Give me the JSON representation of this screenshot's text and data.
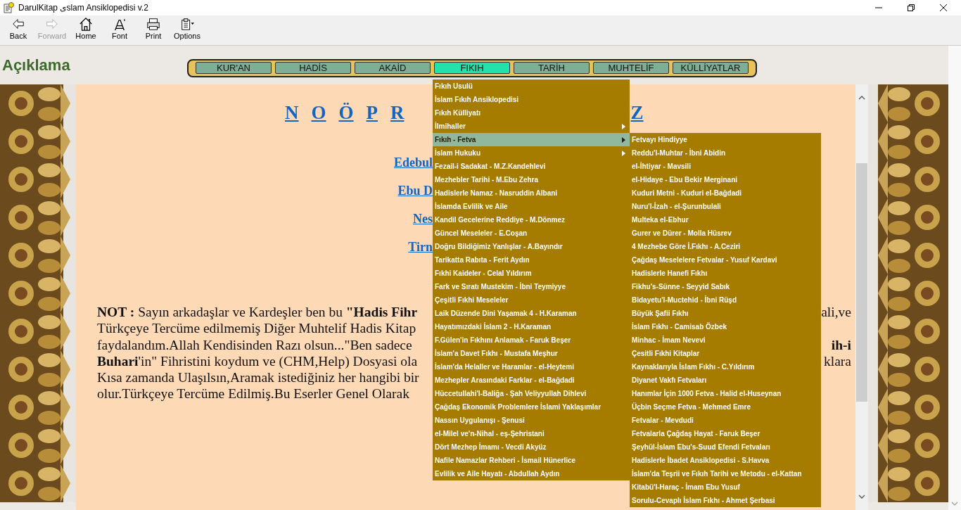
{
  "window": {
    "title": "DarulKitap ىslam Ansiklopedisi v.2"
  },
  "toolbar": [
    {
      "label": "Back",
      "kind": "back",
      "disabled": false
    },
    {
      "label": "Forward",
      "kind": "forward",
      "disabled": true
    },
    {
      "label": "Home",
      "kind": "home",
      "disabled": false
    },
    {
      "label": "Font",
      "kind": "font",
      "disabled": false
    },
    {
      "label": "Print",
      "kind": "print",
      "disabled": false
    },
    {
      "label": "Options",
      "kind": "options",
      "disabled": false
    }
  ],
  "header": {
    "title": "Açıklama"
  },
  "nav_tabs": [
    {
      "label": "KUR'AN",
      "selected": false
    },
    {
      "label": "HADİS",
      "selected": false
    },
    {
      "label": "AKAİD",
      "selected": false
    },
    {
      "label": "FIKIH",
      "selected": true
    },
    {
      "label": "TARİH",
      "selected": false
    },
    {
      "label": "MUHTELİF",
      "selected": false
    },
    {
      "label": "KÜLLİYATLAR",
      "selected": false
    }
  ],
  "content": {
    "letters": [
      "N",
      "O",
      "Ö",
      "P",
      "R"
    ],
    "last_letter": "Z",
    "links": [
      "Edebul",
      "Ebu D",
      "Nes",
      "Tirn"
    ],
    "note_lines": [
      {
        "left": "**NOT :** Sayın arkadaşlar ve Kardeşler ben bu **\"Hadis Fihr**",
        "right": {
          "text": "ali,ve",
          "bold": false
        }
      },
      {
        "left": "Türkçeye Tercüme edilmemiş Diğer Muhtelif Hadis Kitap"
      },
      {
        "left": "faydalandım.Allah Kendisinden Razı olsun...\"Ben sadece",
        "right": {
          "text": "ih-i",
          "bold": true
        }
      },
      {
        "left": "**Buhari**'in\" Fihristini koydum ve (CHM,Help) Dosyasi ola",
        "right": {
          "text": "klara",
          "bold": false
        }
      },
      {
        "left": "Kısa zamanda Ulaşılsın,Aramak istediğiniz her hangibi bir"
      },
      {
        "left": "olur.Türkçeye Tercüme Edilmiş.Bu Eserler Genel Olarak"
      }
    ]
  },
  "menu": {
    "items": [
      {
        "label": "Fıkıh Usulü",
        "selected": false,
        "has_submenu": false
      },
      {
        "label": "İslam Fıkıh Ansiklopedisi",
        "selected": false,
        "has_submenu": false
      },
      {
        "label": "Fıkıh Külliyatı",
        "selected": false,
        "has_submenu": false
      },
      {
        "label": "İlmihaller",
        "selected": false,
        "has_submenu": true
      },
      {
        "label": "Fıkıh - Fetva",
        "selected": true,
        "has_submenu": true
      },
      {
        "label": "İslam Hukuku",
        "selected": false,
        "has_submenu": true
      },
      {
        "label": "Fezail-i Sadakat - M.Z.Kandehlevi",
        "selected": false,
        "has_submenu": false
      },
      {
        "label": "Mezhebler Tarihi - M.Ebu Zehra",
        "selected": false,
        "has_submenu": false
      },
      {
        "label": "Hadislerle Namaz - Nasruddin Albani",
        "selected": false,
        "has_submenu": false
      },
      {
        "label": "İslamda Evlilik ve Aile",
        "selected": false,
        "has_submenu": false
      },
      {
        "label": "Kandil Gecelerine Reddiye - M.Dönmez",
        "selected": false,
        "has_submenu": false
      },
      {
        "label": "Güncel Meseleler - E.Coşan",
        "selected": false,
        "has_submenu": false
      },
      {
        "label": "Doğru Bildiğimiz Yanlışlar - A.Bayındır",
        "selected": false,
        "has_submenu": false
      },
      {
        "label": "Tarikatta Rabıta - Ferit Aydın",
        "selected": false,
        "has_submenu": false
      },
      {
        "label": "Fıkhi Kaideler - Celal Yıldırım",
        "selected": false,
        "has_submenu": false
      },
      {
        "label": "Fark ve Sıratı Mustekim - İbni Teymiyye",
        "selected": false,
        "has_submenu": false
      },
      {
        "label": "Çeşitli Fıkhi Meseleler",
        "selected": false,
        "has_submenu": false
      },
      {
        "label": "Laik Düzende Dini Yaşamak 4 - H.Karaman",
        "selected": false,
        "has_submenu": false
      },
      {
        "label": "Hayatımızdaki İslam 2 - H.Karaman",
        "selected": false,
        "has_submenu": false
      },
      {
        "label": "F.Gülen'in Fıkhını Anlamak - Faruk Beşer",
        "selected": false,
        "has_submenu": false
      },
      {
        "label": "İslam'a Davet Fıkhı - Mustafa Meşhur",
        "selected": false,
        "has_submenu": false
      },
      {
        "label": "İslam'da Helaller ve Haramlar - el-Heytemi",
        "selected": false,
        "has_submenu": false
      },
      {
        "label": "Mezhepler Arasındaki Farklar - el-Bağdadi",
        "selected": false,
        "has_submenu": false
      },
      {
        "label": "Hüccetullahi'l-Baliğa - Şah Veliyyullah Dihlevi",
        "selected": false,
        "has_submenu": false
      },
      {
        "label": "Çağdaş Ekonomik Problemlere İslami Yaklaşımlar",
        "selected": false,
        "has_submenu": false
      },
      {
        "label": "Nassın Uygulanışı - Şenusi",
        "selected": false,
        "has_submenu": false
      },
      {
        "label": "el-Milel ve'n-Nihal - eş-Şehristani",
        "selected": false,
        "has_submenu": false
      },
      {
        "label": "Dört Mezhep İmamı - Vecdi Akyüz",
        "selected": false,
        "has_submenu": false
      },
      {
        "label": "Nafile Namazlar Rehberi - İsmail Hünerlice",
        "selected": false,
        "has_submenu": false
      },
      {
        "label": "Evlilik ve Aile Hayatı - Abdullah Aydın",
        "selected": false,
        "has_submenu": false
      }
    ]
  },
  "submenu": {
    "items": [
      {
        "label": "Fetvayı Hindiyye",
        "selected": false
      },
      {
        "label": "Reddu'l-Muhtar - İbni Abidin",
        "selected": false
      },
      {
        "label": "el-İhtiyar - Mavsili",
        "selected": false
      },
      {
        "label": "el-Hidaye - Ebu Bekir Merginani",
        "selected": false
      },
      {
        "label": "Kuduri Metni - Kuduri el-Bağdadi",
        "selected": false
      },
      {
        "label": "Nuru'l-İzah - el-Şurunbulali",
        "selected": false
      },
      {
        "label": "Multeka el-Ebhur",
        "selected": false
      },
      {
        "label": "Gurer ve Dürer - Molla Hüsrev",
        "selected": false
      },
      {
        "label": "4 Mezhebe Göre İ.Fıkhı - A.Ceziri",
        "selected": false
      },
      {
        "label": "Çağdaş Meselelere Fetvalar - Yusuf Kardavi",
        "selected": false
      },
      {
        "label": "Hadislerle Hanefi Fıkhı",
        "selected": false
      },
      {
        "label": "Fikhu's-Sünne - Seyyid Sabık",
        "selected": false
      },
      {
        "label": "Bidayetu'l-Muctehid - İbni Rüşd",
        "selected": false
      },
      {
        "label": "Büyük Şafii Fıkhı",
        "selected": false
      },
      {
        "label": "İslam Fıkhı - Camisab Özbek",
        "selected": false
      },
      {
        "label": "Minhac - İmam Nevevi",
        "selected": false
      },
      {
        "label": "Çesitli Fıkhi Kitaplar",
        "selected": false
      },
      {
        "label": "Kaynaklarıyla İslam Fıkhı - C.Yıldırım",
        "selected": false
      },
      {
        "label": "Diyanet Vakfı Fetvaları",
        "selected": false
      },
      {
        "label": "Hanımlar İçin 1000 Fetva - Halid el-Huseynan",
        "selected": false
      },
      {
        "label": "Üçbin Seçme Fetva - Mehmed Emre",
        "selected": false
      },
      {
        "label": "Fetvalar - Mevdudi",
        "selected": false
      },
      {
        "label": "Fetvalarla Çağdaş Hayat - Faruk Beşer",
        "selected": false
      },
      {
        "label": "Şeyhül-İslam Ebu's-Suud Efendi Fetvaları",
        "selected": false
      },
      {
        "label": "Hadislerle İbadet Ansiklopedisi - S.Havva",
        "selected": false
      },
      {
        "label": "İslam'da Teşrii ve Fıkıh Tarihi ve Metodu - el-Kattan",
        "selected": false
      },
      {
        "label": "Kitabü'l-Haraç - İmam Ebu Yusuf",
        "selected": false
      },
      {
        "label": "Sorulu-Cevaplı İslam Fıkhı - Ahmet Şerbasi",
        "selected": false
      }
    ]
  }
}
